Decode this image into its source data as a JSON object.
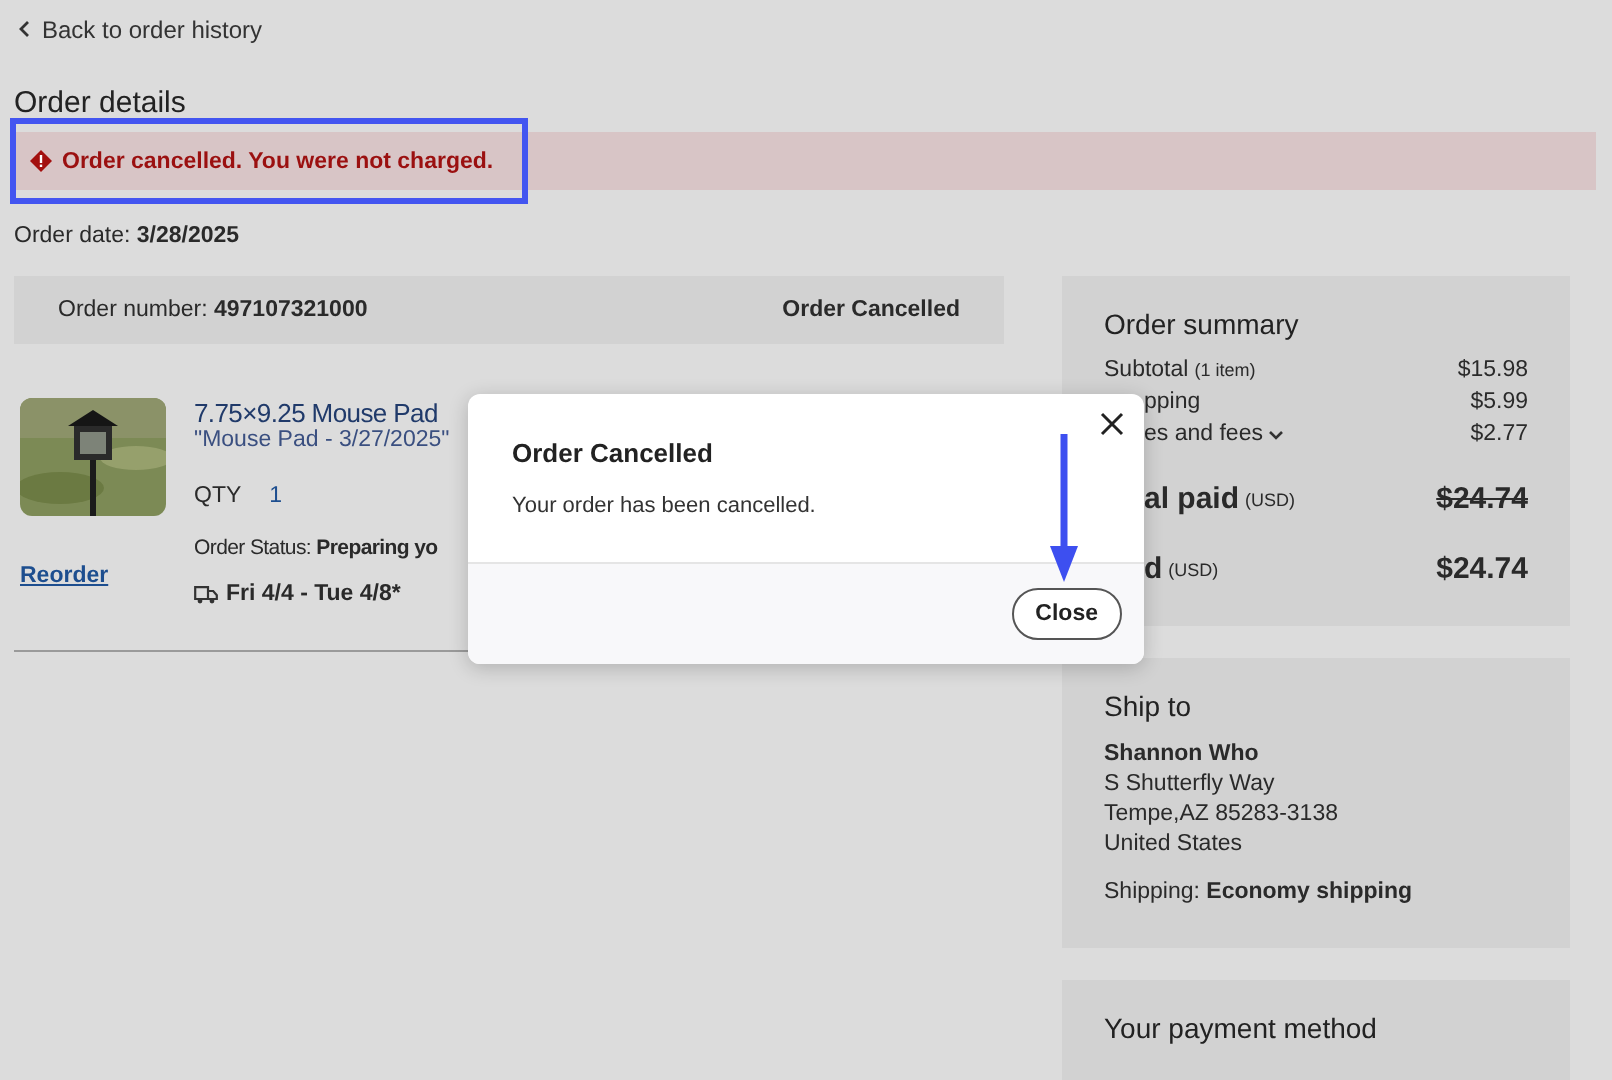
{
  "back_link": "Back to order history",
  "heading": "Order details",
  "alert": {
    "text": "Order cancelled. You were not charged.",
    "highlighted": true
  },
  "order_date": {
    "label": "Order date:",
    "value": "3/28/2025"
  },
  "order_bar": {
    "label": "Order number:",
    "value": "497107321000",
    "status": "Order Cancelled"
  },
  "item": {
    "title": "7.75×9.25 Mouse Pad",
    "subtitle": "\"Mouse Pad - 3/27/2025\"",
    "qty_label": "QTY",
    "qty": "1",
    "status_label": "Order Status:",
    "status": "Preparing yo",
    "delivery": "Fri 4/4 - Tue 4/8*",
    "reorder": "Reorder"
  },
  "summary": {
    "title": "Order summary",
    "rows": [
      {
        "kind": "line",
        "label": "Subtotal",
        "note": "(1 item)",
        "value": "$15.98"
      },
      {
        "kind": "partial",
        "label": "pping",
        "value": "$5.99"
      },
      {
        "kind": "partial-dropdown",
        "label": "es and fees",
        "value": "$2.77"
      },
      {
        "kind": "total-struck",
        "label": "al paid",
        "note": "(USD)",
        "value": "$24.74"
      },
      {
        "kind": "total",
        "label": "d",
        "note": "(USD)",
        "value": "$24.74"
      }
    ]
  },
  "ship_to": {
    "title": "Ship to",
    "name": "Shannon Who",
    "lines": [
      "S Shutterfly Way",
      "Tempe,AZ 85283-3138",
      "United States"
    ],
    "shipping_label": "Shipping:",
    "shipping": "Economy shipping"
  },
  "payment": {
    "title": "Your payment method"
  },
  "dialog": {
    "title": "Order Cancelled",
    "message": "Your order has been cancelled.",
    "button": "Close",
    "pointer_arrow": true
  }
}
